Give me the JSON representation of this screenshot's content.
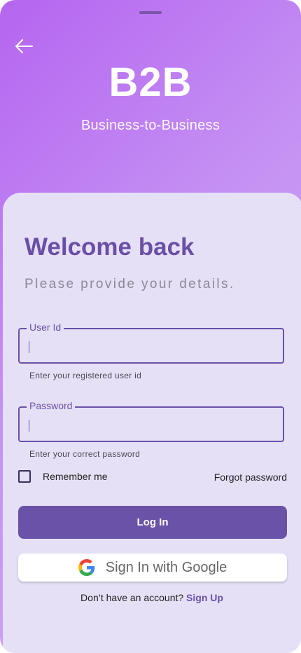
{
  "header": {
    "brand": "B2B",
    "tagline": "Business-to-Business"
  },
  "login": {
    "title": "Welcome back",
    "subtitle": "Please provide your details.",
    "user_id": {
      "label": "User Id",
      "value": "",
      "helper": "Enter your registered user id"
    },
    "password": {
      "label": "Password",
      "value": "",
      "helper": "Enter your correct password"
    },
    "remember_label": "Remember me",
    "remember_checked": false,
    "forgot_label": "Forgot password",
    "login_label": "Log In",
    "google_label": "Sign In with Google",
    "signup_prompt": "Don’t have an account?",
    "signup_link": "Sign Up"
  },
  "icons": {
    "back": "arrow-left-icon",
    "google": "google-g-icon"
  },
  "colors": {
    "primary": "#6a52a8",
    "card": "#e6e0f6",
    "gradient_start": "#b565f0",
    "gradient_end": "#d2b2f2"
  }
}
